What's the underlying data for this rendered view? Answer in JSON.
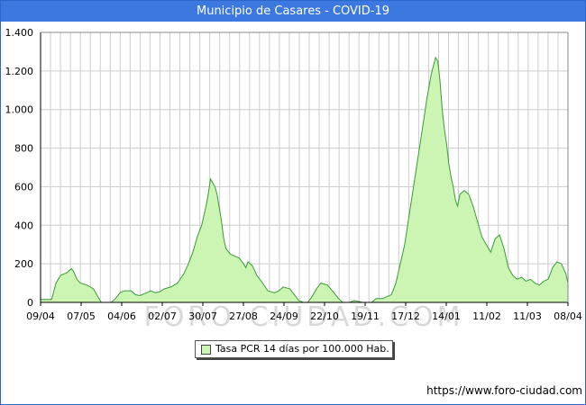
{
  "title": "Municipio de Casares - COVID-19",
  "legend_label": "Tasa PCR 14 días por 100.000 Hab.",
  "source": "https://www.foro-ciudad.com",
  "watermark": "FORO-CIUDAD.COM",
  "colors": {
    "title_bg": "#3b78e0",
    "fill": "#ccf5b3",
    "line": "#3a9a3a",
    "grid": "#cccccc"
  },
  "chart_data": {
    "type": "area",
    "title": "Municipio de Casares - COVID-19",
    "xlabel": "",
    "ylabel": "",
    "ylim": [
      0,
      1400
    ],
    "y_ticks": [
      0,
      200,
      400,
      600,
      800,
      1000,
      1200,
      1400
    ],
    "y_tick_labels": [
      "0",
      "200",
      "400",
      "600",
      "800",
      "1.000",
      "1.200",
      "1.400"
    ],
    "x_tick_labels": [
      "09/04",
      "07/05",
      "04/06",
      "02/07",
      "30/07",
      "27/08",
      "24/09",
      "22/10",
      "19/11",
      "17/12",
      "14/01",
      "11/02",
      "11/03",
      "08/04"
    ],
    "grid": true,
    "series": [
      {
        "name": "Tasa PCR 14 días por 100.000 Hab.",
        "x_range": [
          "09/04",
          "08/04"
        ],
        "points": [
          [
            0,
            15
          ],
          [
            10,
            15
          ],
          [
            14,
            100
          ],
          [
            18,
            140
          ],
          [
            24,
            155
          ],
          [
            28,
            175
          ],
          [
            30,
            160
          ],
          [
            33,
            120
          ],
          [
            36,
            100
          ],
          [
            42,
            90
          ],
          [
            48,
            70
          ],
          [
            52,
            30
          ],
          [
            55,
            0
          ],
          [
            64,
            0
          ],
          [
            68,
            20
          ],
          [
            72,
            50
          ],
          [
            76,
            60
          ],
          [
            82,
            60
          ],
          [
            86,
            40
          ],
          [
            90,
            35
          ],
          [
            96,
            50
          ],
          [
            100,
            60
          ],
          [
            104,
            50
          ],
          [
            108,
            55
          ],
          [
            112,
            70
          ],
          [
            118,
            80
          ],
          [
            124,
            100
          ],
          [
            130,
            150
          ],
          [
            134,
            200
          ],
          [
            138,
            260
          ],
          [
            142,
            340
          ],
          [
            146,
            400
          ],
          [
            150,
            500
          ],
          [
            152,
            560
          ],
          [
            154,
            640
          ],
          [
            156,
            620
          ],
          [
            158,
            600
          ],
          [
            160,
            560
          ],
          [
            164,
            420
          ],
          [
            166,
            330
          ],
          [
            168,
            280
          ],
          [
            172,
            250
          ],
          [
            176,
            240
          ],
          [
            180,
            230
          ],
          [
            184,
            200
          ],
          [
            186,
            180
          ],
          [
            188,
            210
          ],
          [
            192,
            190
          ],
          [
            196,
            140
          ],
          [
            200,
            110
          ],
          [
            206,
            60
          ],
          [
            212,
            50
          ],
          [
            216,
            60
          ],
          [
            220,
            80
          ],
          [
            226,
            70
          ],
          [
            230,
            40
          ],
          [
            234,
            10
          ],
          [
            238,
            0
          ],
          [
            242,
            0
          ],
          [
            246,
            30
          ],
          [
            250,
            70
          ],
          [
            254,
            100
          ],
          [
            260,
            90
          ],
          [
            266,
            50
          ],
          [
            270,
            20
          ],
          [
            274,
            0
          ],
          [
            280,
            0
          ],
          [
            284,
            10
          ],
          [
            292,
            0
          ],
          [
            300,
            0
          ],
          [
            304,
            20
          ],
          [
            310,
            20
          ],
          [
            314,
            30
          ],
          [
            318,
            40
          ],
          [
            322,
            100
          ],
          [
            326,
            200
          ],
          [
            330,
            300
          ],
          [
            334,
            450
          ],
          [
            338,
            600
          ],
          [
            342,
            750
          ],
          [
            346,
            900
          ],
          [
            350,
            1050
          ],
          [
            354,
            1180
          ],
          [
            358,
            1270
          ],
          [
            360,
            1250
          ],
          [
            362,
            1150
          ],
          [
            364,
            1000
          ],
          [
            366,
            900
          ],
          [
            368,
            820
          ],
          [
            370,
            720
          ],
          [
            372,
            650
          ],
          [
            374,
            600
          ],
          [
            376,
            530
          ],
          [
            378,
            500
          ],
          [
            380,
            560
          ],
          [
            384,
            580
          ],
          [
            388,
            560
          ],
          [
            392,
            500
          ],
          [
            396,
            420
          ],
          [
            400,
            340
          ],
          [
            404,
            300
          ],
          [
            408,
            260
          ],
          [
            412,
            330
          ],
          [
            416,
            350
          ],
          [
            420,
            280
          ],
          [
            424,
            180
          ],
          [
            428,
            140
          ],
          [
            432,
            120
          ],
          [
            436,
            130
          ],
          [
            440,
            110
          ],
          [
            444,
            120
          ],
          [
            448,
            100
          ],
          [
            452,
            90
          ],
          [
            456,
            110
          ],
          [
            460,
            120
          ],
          [
            464,
            180
          ],
          [
            468,
            210
          ],
          [
            472,
            200
          ],
          [
            476,
            150
          ],
          [
            478,
            100
          ]
        ]
      }
    ]
  }
}
